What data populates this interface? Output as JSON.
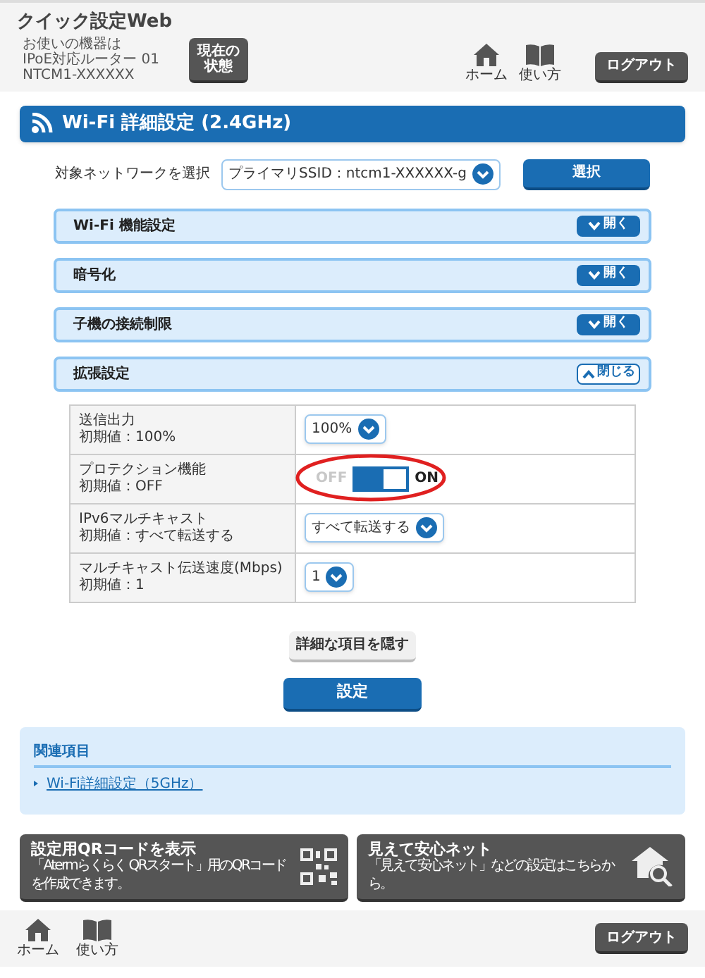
{
  "header": {
    "app_title": "クイック設定Web",
    "device_info": [
      "お使いの機器は",
      "IPoE対応ルーター 01",
      "NTCM1-XXXXXX"
    ],
    "status_button": [
      "現在の",
      "状態"
    ],
    "nav": [
      {
        "kind": "home",
        "label": "ホーム"
      },
      {
        "kind": "guide",
        "label": "使い方"
      }
    ],
    "logout": "ログアウト"
  },
  "page_title": "Wi-Fi 詳細設定 (2.4GHz)",
  "network_select": {
    "label": "対象ネットワークを選択",
    "value": "プライマリSSID：ntcm1-XXXXXX-g",
    "button": "選択"
  },
  "sections": [
    {
      "title": "Wi-Fi 機能設定",
      "expanded": false,
      "toggle": "開く"
    },
    {
      "title": "暗号化",
      "expanded": false,
      "toggle": "開く"
    },
    {
      "title": "子機の接続制限",
      "expanded": false,
      "toggle": "開く"
    },
    {
      "title": "拡張設定",
      "expanded": true,
      "toggle": "閉じる"
    }
  ],
  "settings": [
    {
      "kind": "select",
      "name": "送信出力",
      "default": "初期値：100%",
      "value": "100%"
    },
    {
      "kind": "switch",
      "name": "プロテクション機能",
      "default": "初期値：OFF",
      "off_label": "OFF",
      "on_label": "ON",
      "on": true,
      "highlighted": true
    },
    {
      "kind": "select",
      "name": "IPv6マルチキャスト",
      "default": "初期値：すべて転送する",
      "value": "すべて転送する"
    },
    {
      "kind": "select",
      "name": "マルチキャスト伝送速度(Mbps)",
      "default": "初期値：1",
      "value": "1"
    }
  ],
  "hide_button": "詳細な項目を隠す",
  "apply_button": "設定",
  "related": {
    "title": "関連項目",
    "links": [
      "Wi-Fi詳細設定（5GHz）"
    ]
  },
  "promos": [
    {
      "kind": "qr",
      "title": "設定用QRコードを表示",
      "subtitle": "「Atermらくらく QRスタート」用のQRコードを作成できます。"
    },
    {
      "kind": "net",
      "title": "見えて安心ネット",
      "subtitle": "「見えて安心ネット」などの設定はこちらから。"
    }
  ],
  "footer": {
    "nav": [
      {
        "kind": "home",
        "label": "ホーム"
      },
      {
        "kind": "guide",
        "label": "使い方"
      }
    ],
    "logout": "ログアウト"
  }
}
